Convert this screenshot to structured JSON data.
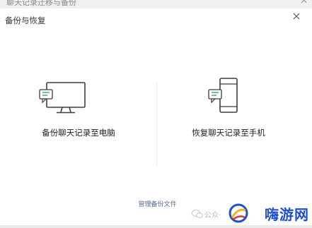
{
  "titlebar": {
    "title": "聊天记录迁移与备份"
  },
  "window": {
    "title": "备份与恢复"
  },
  "options": {
    "backup_label": "备份聊天记录至电脑",
    "restore_label": "恢复聊天记录至手机"
  },
  "manage_link": "管理备份文件",
  "watermark": {
    "left_text": "公众·",
    "logo_text": "嗨游网"
  },
  "icons": {
    "close": "close-icon",
    "computer": "computer-chat-icon",
    "phone": "phone-chat-icon",
    "wechat": "wechat-icon"
  },
  "colors": {
    "accent_green": "#2aae67",
    "link": "#576b95",
    "icon_stroke": "#3d3d3d",
    "logo": "#1f4fd1"
  }
}
